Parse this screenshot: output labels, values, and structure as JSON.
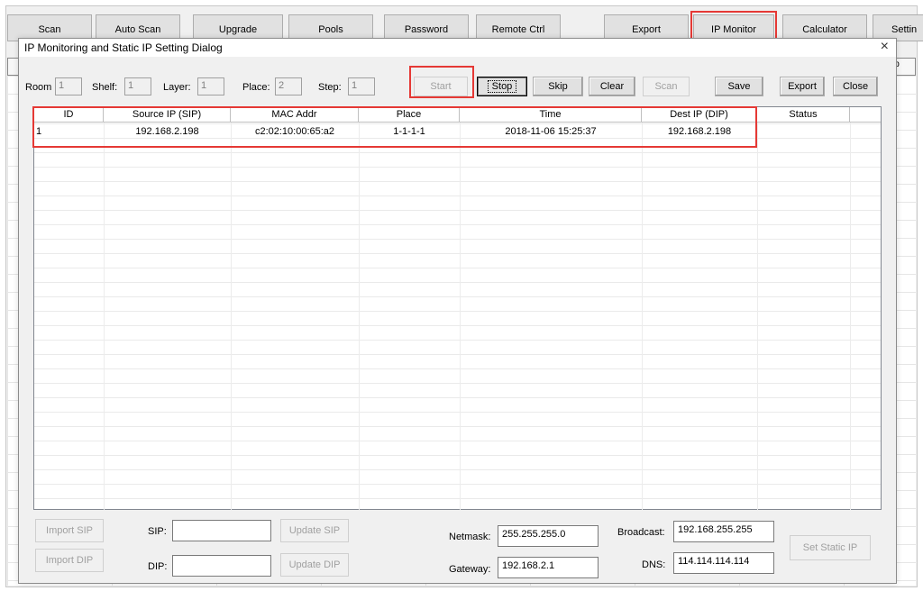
{
  "toolbar": {
    "buttons": [
      "Scan",
      "Auto Scan",
      "Upgrade",
      "Pools",
      "Password",
      "Remote Ctrl",
      "Export",
      "IP Monitor",
      "Calculator",
      "Settin"
    ]
  },
  "background": {
    "partial_header": "ip"
  },
  "dialog": {
    "title": "IP Monitoring and Static IP Setting Dialog",
    "close": "×",
    "fields": {
      "room_label": "Room",
      "room_value": "1",
      "shelf_label": "Shelf:",
      "shelf_value": "1",
      "layer_label": "Layer:",
      "layer_value": "1",
      "place_label": "Place:",
      "place_value": "2",
      "step_label": "Step:",
      "step_value": "1"
    },
    "buttons": {
      "start": "Start",
      "stop": "Stop",
      "skip": "Skip",
      "clear": "Clear",
      "scan": "Scan",
      "save": "Save",
      "export": "Export",
      "close": "Close"
    },
    "table": {
      "columns": [
        "ID",
        "Source IP (SIP)",
        "MAC Addr",
        "Place",
        "Time",
        "Dest IP (DIP)",
        "Status"
      ],
      "rows": [
        [
          "1",
          "192.168.2.198",
          "c2:02:10:00:65:a2",
          "1-1-1-1",
          "2018-11-06 15:25:37",
          "192.168.2.198",
          ""
        ]
      ]
    },
    "bottom": {
      "import_sip": "Import SIP",
      "import_dip": "Import DIP",
      "sip_label": "SIP:",
      "sip_value": "",
      "dip_label": "DIP:",
      "dip_value": "",
      "update_sip": "Update SIP",
      "update_dip": "Update DIP",
      "netmask_label": "Netmask:",
      "netmask_value": "255.255.255.0",
      "gateway_label": "Gateway:",
      "gateway_value": "192.168.2.1",
      "broadcast_label": "Broadcast:",
      "broadcast_value": "192.168.255.255",
      "dns_label": "DNS:",
      "dns_value": "114.114.114.114",
      "set_static_ip": "Set Static IP"
    }
  },
  "colors": {
    "highlight": "#e53935",
    "dialog_bg": "#f0f0f0"
  }
}
